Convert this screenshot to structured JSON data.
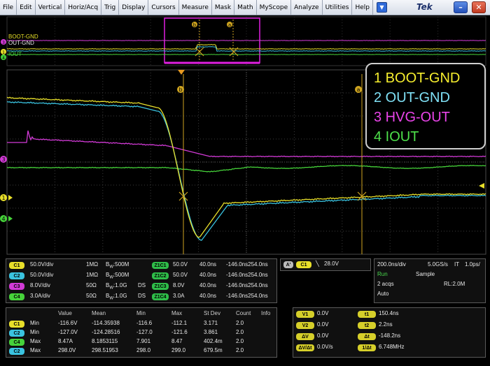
{
  "menu": {
    "items": [
      "File",
      "Edit",
      "Vertical",
      "Horiz/Acq",
      "Trig",
      "Display",
      "Cursors",
      "Measure",
      "Mask",
      "Math",
      "MyScope",
      "Analyze",
      "Utilities",
      "Help"
    ],
    "brand": "Tek",
    "minimize_glyph": "–",
    "close_glyph": "✕",
    "dropdown_glyph": "▼"
  },
  "colors": {
    "ch1": "#e8df2a",
    "ch2": "#3ac3e0",
    "ch3": "#d23ad6",
    "ch4": "#46d33a",
    "cursor": "#cfa520",
    "zoom_box": "#e01fe0"
  },
  "overview": {
    "labels": [
      "BOOT-GND",
      "OUT-GND",
      "IOUT"
    ]
  },
  "legend": [
    {
      "text": "1 BOOT-GND",
      "color": "#f6ee2e"
    },
    {
      "text": "2 OUT-GND",
      "color": "#7fe0f5"
    },
    {
      "text": "3 HVG-OUT",
      "color": "#ea44ea"
    },
    {
      "text": "4 IOUT",
      "color": "#4ee04a"
    }
  ],
  "markers": {
    "ch1": "1",
    "ch2": "2",
    "ch3": "3",
    "ch4": "4",
    "cursor_a": "a",
    "cursor_b": "b"
  },
  "channels": [
    {
      "badge": "C1",
      "scale": "50.0V/div",
      "imp": "1MΩ",
      "bw": "500M",
      "ds": "",
      "zbadge": "Z1C1",
      "zscale": "50.0V",
      "zpos": "40.0ns",
      "zrange": "-146.0ns254.0ns"
    },
    {
      "badge": "C2",
      "scale": "50.0V/div",
      "imp": "1MΩ",
      "bw": "500M",
      "ds": "",
      "zbadge": "Z1C2",
      "zscale": "50.0V",
      "zpos": "40.0ns",
      "zrange": "-146.0ns254.0ns"
    },
    {
      "badge": "C3",
      "scale": "8.0V/div",
      "imp": "50Ω",
      "bw": "1.0G",
      "ds": "DS",
      "zbadge": "Z1C3",
      "zscale": "8.0V",
      "zpos": "40.0ns",
      "zrange": "-146.0ns254.0ns"
    },
    {
      "badge": "C4",
      "scale": "3.0A/div",
      "imp": "50Ω",
      "bw": "1.0G",
      "ds": "DS",
      "zbadge": "Z1C4",
      "zscale": "3.0A",
      "zpos": "40.0ns",
      "zrange": "-146.0ns254.0ns"
    }
  ],
  "bw_prefix": "B",
  "bw_sub": "W",
  "bw_suffix": ":",
  "trigger": {
    "mode": "A'",
    "source": "C1",
    "slope": "╲",
    "level": "28.0V"
  },
  "acquisition": {
    "timebase": "200.0ns/div",
    "rate": "5.0GS/s",
    "it": "IT",
    "it_value": "1.0ps/",
    "state": "Run",
    "mode": "Sample",
    "acqs": "2 acqs",
    "rl": "RL:2.0M",
    "trig_mode": "Auto"
  },
  "measurements": {
    "headers": [
      "Value",
      "Mean",
      "Min",
      "Max",
      "St Dev",
      "Count",
      "Info"
    ],
    "rows": [
      {
        "badge": "C1",
        "name": "Min",
        "value": "-116.6V",
        "mean": "-114.35938",
        "min": "-116.6",
        "max": "-112.1",
        "stdev": "3.171",
        "count": "2.0"
      },
      {
        "badge": "C2",
        "name": "Min",
        "value": "-127.0V",
        "mean": "-124.28516",
        "min": "-127.0",
        "max": "-121.6",
        "stdev": "3.861",
        "count": "2.0"
      },
      {
        "badge": "C4",
        "name": "Max",
        "value": "8.47A",
        "mean": "8.1853115",
        "min": "7.901",
        "max": "8.47",
        "stdev": "402.4m",
        "count": "2.0"
      },
      {
        "badge": "C2",
        "name": "Max",
        "value": "298.0V",
        "mean": "298.51953",
        "min": "298.0",
        "max": "299.0",
        "stdev": "679.5m",
        "count": "2.0"
      }
    ]
  },
  "cursors": {
    "left": [
      {
        "badge": "V1",
        "value": "0.0V"
      },
      {
        "badge": "V2",
        "value": "0.0V"
      },
      {
        "badge": "ΔV",
        "value": "0.0V"
      },
      {
        "badge": "ΔV/Δt",
        "value": "0.0V/s"
      }
    ],
    "right": [
      {
        "badge": "t1",
        "value": "150.4ns"
      },
      {
        "badge": "t2",
        "value": "2.2ns"
      },
      {
        "badge": "Δt",
        "value": "-148.2ns"
      },
      {
        "badge": "1/Δt",
        "value": "6.748MHz"
      }
    ]
  }
}
